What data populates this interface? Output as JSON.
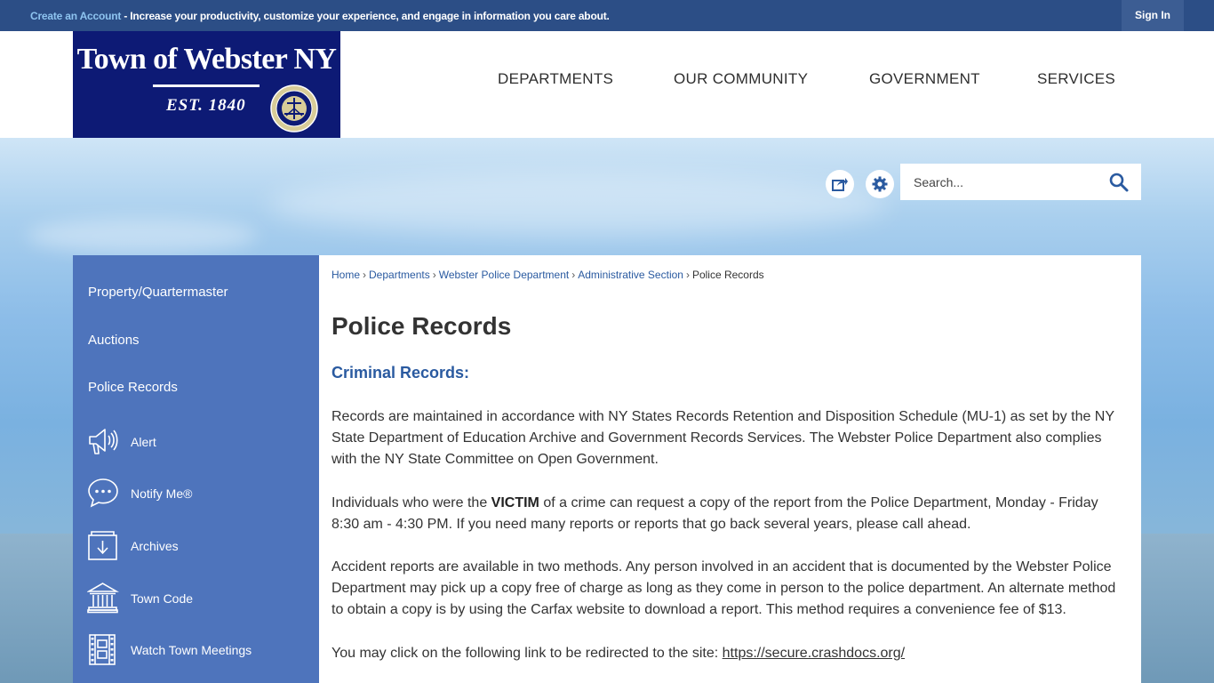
{
  "topbar": {
    "create_account": "Create an Account",
    "message": " - Increase your productivity, customize your experience, and engage in information you care about.",
    "sign_in": "Sign In"
  },
  "logo": {
    "title": "Town of Webster NY",
    "est": "EST. 1840"
  },
  "nav": {
    "items": [
      "DEPARTMENTS",
      "OUR COMMUNITY",
      "GOVERNMENT",
      "SERVICES"
    ]
  },
  "tools": {
    "share_icon": "share-icon",
    "settings_icon": "gear-icon",
    "search_placeholder": "Search..."
  },
  "sidebar": {
    "links": [
      "Property/Quartermaster",
      "Auctions",
      "Police Records"
    ],
    "quick_links": [
      {
        "label": "Alert",
        "icon": "megaphone-icon"
      },
      {
        "label": "Notify Me®",
        "icon": "chat-bubble-icon"
      },
      {
        "label": "Archives",
        "icon": "archive-box-icon"
      },
      {
        "label": "Town Code",
        "icon": "government-building-icon"
      },
      {
        "label": "Watch Town Meetings",
        "icon": "film-strip-icon"
      }
    ]
  },
  "breadcrumb": {
    "items": [
      "Home",
      "Departments",
      "Webster Police Department",
      "Administrative Section"
    ],
    "current": "Police Records"
  },
  "content": {
    "title": "Police Records",
    "section_heading": "Criminal Records:",
    "p1": "Records are maintained in accordance with NY States Records Retention and Disposition Schedule (MU-1) as set by the NY State Department of Education Archive and Government Records Services. The Webster Police Department also complies with the NY State Committee on Open Government.",
    "p2_before": "Individuals who were the ",
    "p2_bold": "VICTIM",
    "p2_after": " of a crime can request a copy of the report from the Police Department, Monday - Friday 8:30 am - 4:30 PM. If you need many reports or reports that go back several years, please call ahead.",
    "p3": "Accident reports are available in two methods. Any person involved in an accident that is documented by the Webster Police Department may pick up a copy free of charge as long as they come in person to the police department. An alternate method to obtain a copy is by using the Carfax website to download a report. This method requires a convenience fee of $13.",
    "p4_before": "You may click on the following link to be redirected to the site: ",
    "p4_link": "https://secure.crashdocs.org/"
  },
  "colors": {
    "topbar": "#2c4e86",
    "logo_bg": "#0d1a75",
    "sidebar": "#4e74bc",
    "link": "#2a5aa0"
  }
}
